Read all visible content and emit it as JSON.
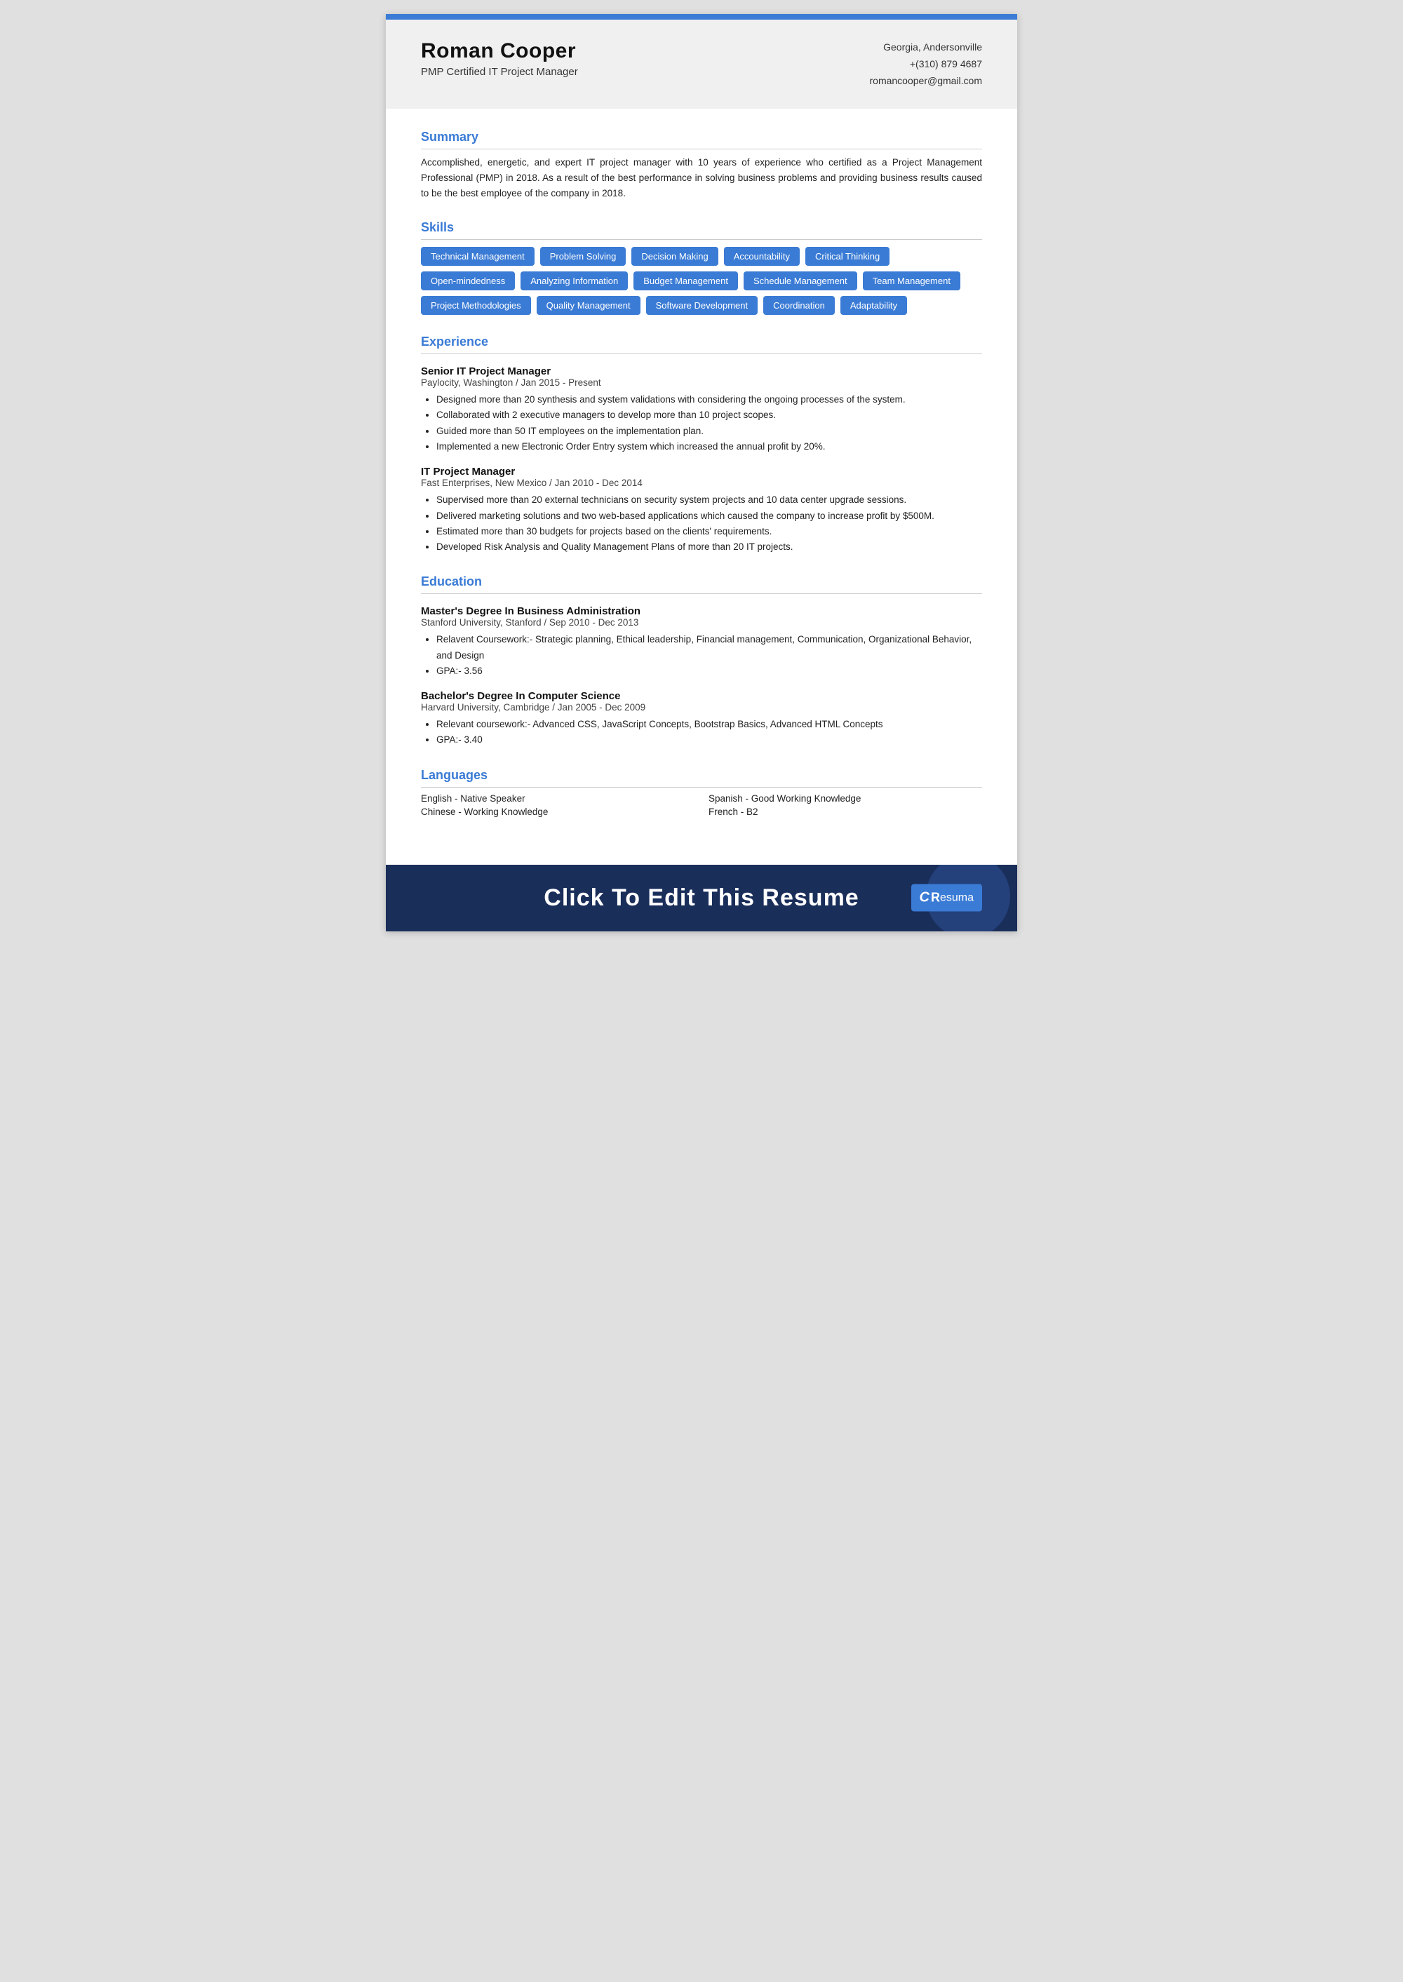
{
  "header": {
    "name": "Roman Cooper",
    "subtitle": "PMP Certified IT Project Manager",
    "location": "Georgia, Andersonville",
    "phone": "+(310) 879 4687",
    "email": "romancooper@gmail.com"
  },
  "sections": {
    "summary": {
      "title": "Summary",
      "text": "Accomplished, energetic, and expert IT project manager with 10 years of experience who certified as a Project Management Professional (PMP) in 2018. As a result of the best performance in solving business problems and providing business results caused to be the best employee of the company in 2018."
    },
    "skills": {
      "title": "Skills",
      "items": [
        "Technical Management",
        "Problem Solving",
        "Decision Making",
        "Accountability",
        "Critical Thinking",
        "Open-mindedness",
        "Analyzing Information",
        "Budget Management",
        "Schedule Management",
        "Team Management",
        "Project Methodologies",
        "Quality Management",
        "Software Development",
        "Coordination",
        "Adaptability"
      ]
    },
    "experience": {
      "title": "Experience",
      "jobs": [
        {
          "title": "Senior IT Project Manager",
          "company": "Paylocity, Washington / Jan 2015 - Present",
          "bullets": [
            "Designed more than 20 synthesis and system validations with considering the ongoing processes of the system.",
            "Collaborated with 2 executive managers to develop more than 10 project scopes.",
            "Guided more than 50 IT employees on the implementation plan.",
            "Implemented a new Electronic Order Entry system which increased the annual profit by 20%."
          ]
        },
        {
          "title": "IT Project Manager",
          "company": "Fast Enterprises, New Mexico / Jan 2010 - Dec 2014",
          "bullets": [
            "Supervised more than 20 external technicians on security system projects and 10 data center upgrade sessions.",
            "Delivered marketing solutions and two web-based applications which caused the company to increase profit by $500M.",
            "Estimated more than 30 budgets for projects based on the clients' requirements.",
            "Developed Risk Analysis and Quality Management Plans of more than 20 IT projects."
          ]
        }
      ]
    },
    "education": {
      "title": "Education",
      "degrees": [
        {
          "title": "Master's Degree In Business Administration",
          "school": "Stanford University, Stanford / Sep 2010 - Dec 2013",
          "bullets": [
            "Relavent Coursework:- Strategic planning, Ethical leadership, Financial management, Communication, Organizational Behavior, and Design",
            "GPA:- 3.56"
          ]
        },
        {
          "title": "Bachelor's Degree In Computer Science",
          "school": "Harvard University, Cambridge / Jan 2005 - Dec 2009",
          "bullets": [
            "Relevant coursework:- Advanced CSS, JavaScript Concepts,  Bootstrap Basics, Advanced HTML Concepts",
            "GPA:- 3.40"
          ]
        }
      ]
    },
    "languages": {
      "title": "Languages",
      "items": [
        {
          "label": "English - Native Speaker"
        },
        {
          "label": "Spanish - Good Working Knowledge"
        },
        {
          "label": "Chinese - Working Knowledge"
        },
        {
          "label": "French - B2"
        }
      ]
    }
  },
  "footer": {
    "cta": "Click To Edit This Resume",
    "logo": "CResuma"
  }
}
